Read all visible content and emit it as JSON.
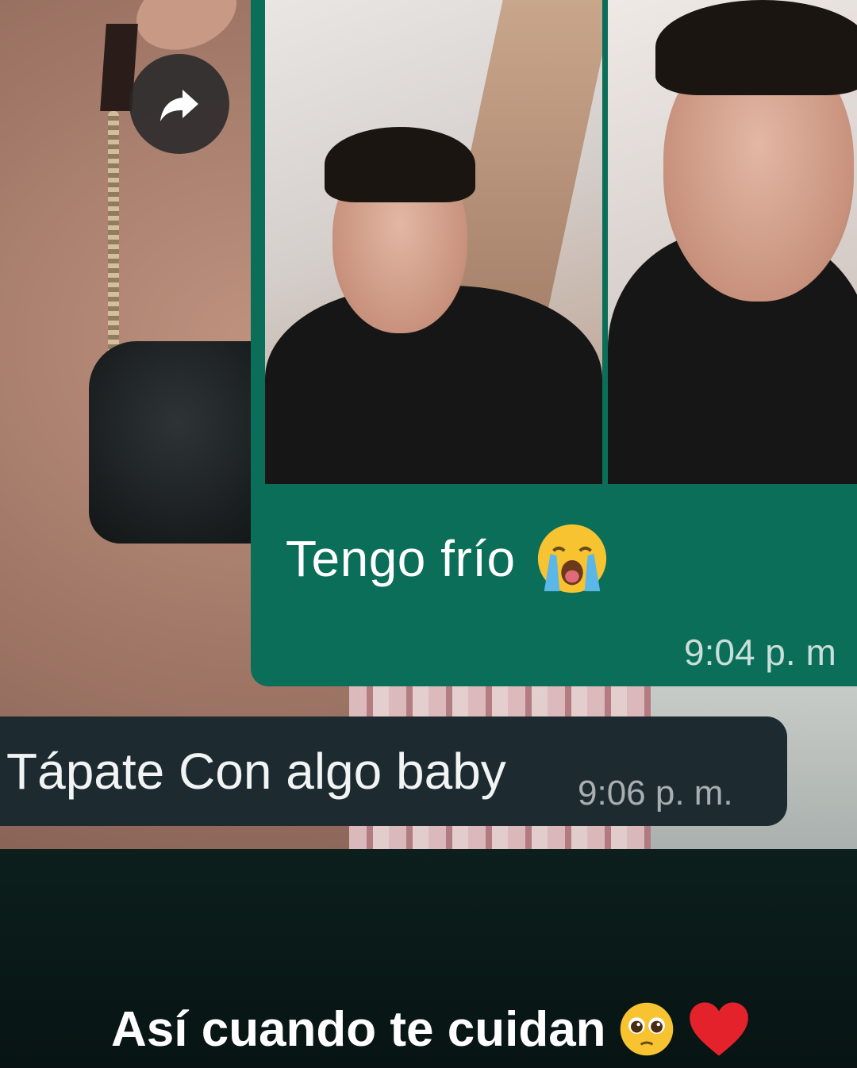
{
  "chat": {
    "outgoing_message": {
      "text": "Tengo frío",
      "emoji": "loudly-crying-face",
      "time": "9:04 p. m"
    },
    "incoming_message": {
      "text": "Tápate Con algo baby",
      "time": "9:06 p. m."
    },
    "forward_icon": "forward-arrow-icon"
  },
  "caption": {
    "text": "Así cuando te cuidan",
    "emojis": [
      "pleading-face",
      "red-heart"
    ]
  },
  "colors": {
    "outgoing_bubble": "#0b6e58",
    "incoming_bubble": "#1d2b31",
    "bottom_background": "#0c1f1d",
    "text_primary": "#ffffff"
  }
}
